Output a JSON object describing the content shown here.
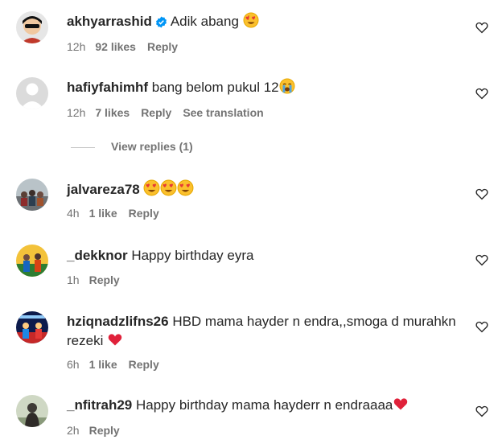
{
  "comments": [
    {
      "username": "akhyarrashid",
      "text": "Adik abang",
      "time": "12h",
      "likes": "92 likes",
      "reply": "Reply",
      "translation": ""
    },
    {
      "username": "hafiyfahimhf",
      "text": "bang belom pukul 12",
      "time": "12h",
      "likes": "7 likes",
      "reply": "Reply",
      "translation": "See translation"
    },
    {
      "username": "jalvareza78",
      "text": "",
      "time": "4h",
      "likes": "1 like",
      "reply": "Reply"
    },
    {
      "username": "_dekknor",
      "text": "Happy birthday eyra",
      "time": "1h",
      "reply": "Reply"
    },
    {
      "username": "hziqnadzlifns26",
      "text": "HBD mama hayder n endra,,smoga d murahkn",
      "text2": "rezeki",
      "time": "6h",
      "likes": "1 like",
      "reply": "Reply"
    },
    {
      "username": "_nfitrah29",
      "text": "Happy birthday mama hayderr n endraaaa",
      "time": "2h",
      "reply": "Reply"
    }
  ],
  "view_replies": "View replies (1)",
  "icons": {
    "like": "heart-outline-icon",
    "verified": "verified-badge-icon",
    "heart_eyes": "heart-eyes-emoji",
    "crying": "crying-emoji",
    "red_heart": "red-heart-emoji"
  },
  "colors": {
    "text": "#262626",
    "muted": "#737373",
    "verified": "#0095f6",
    "heart": "#e0213a"
  }
}
